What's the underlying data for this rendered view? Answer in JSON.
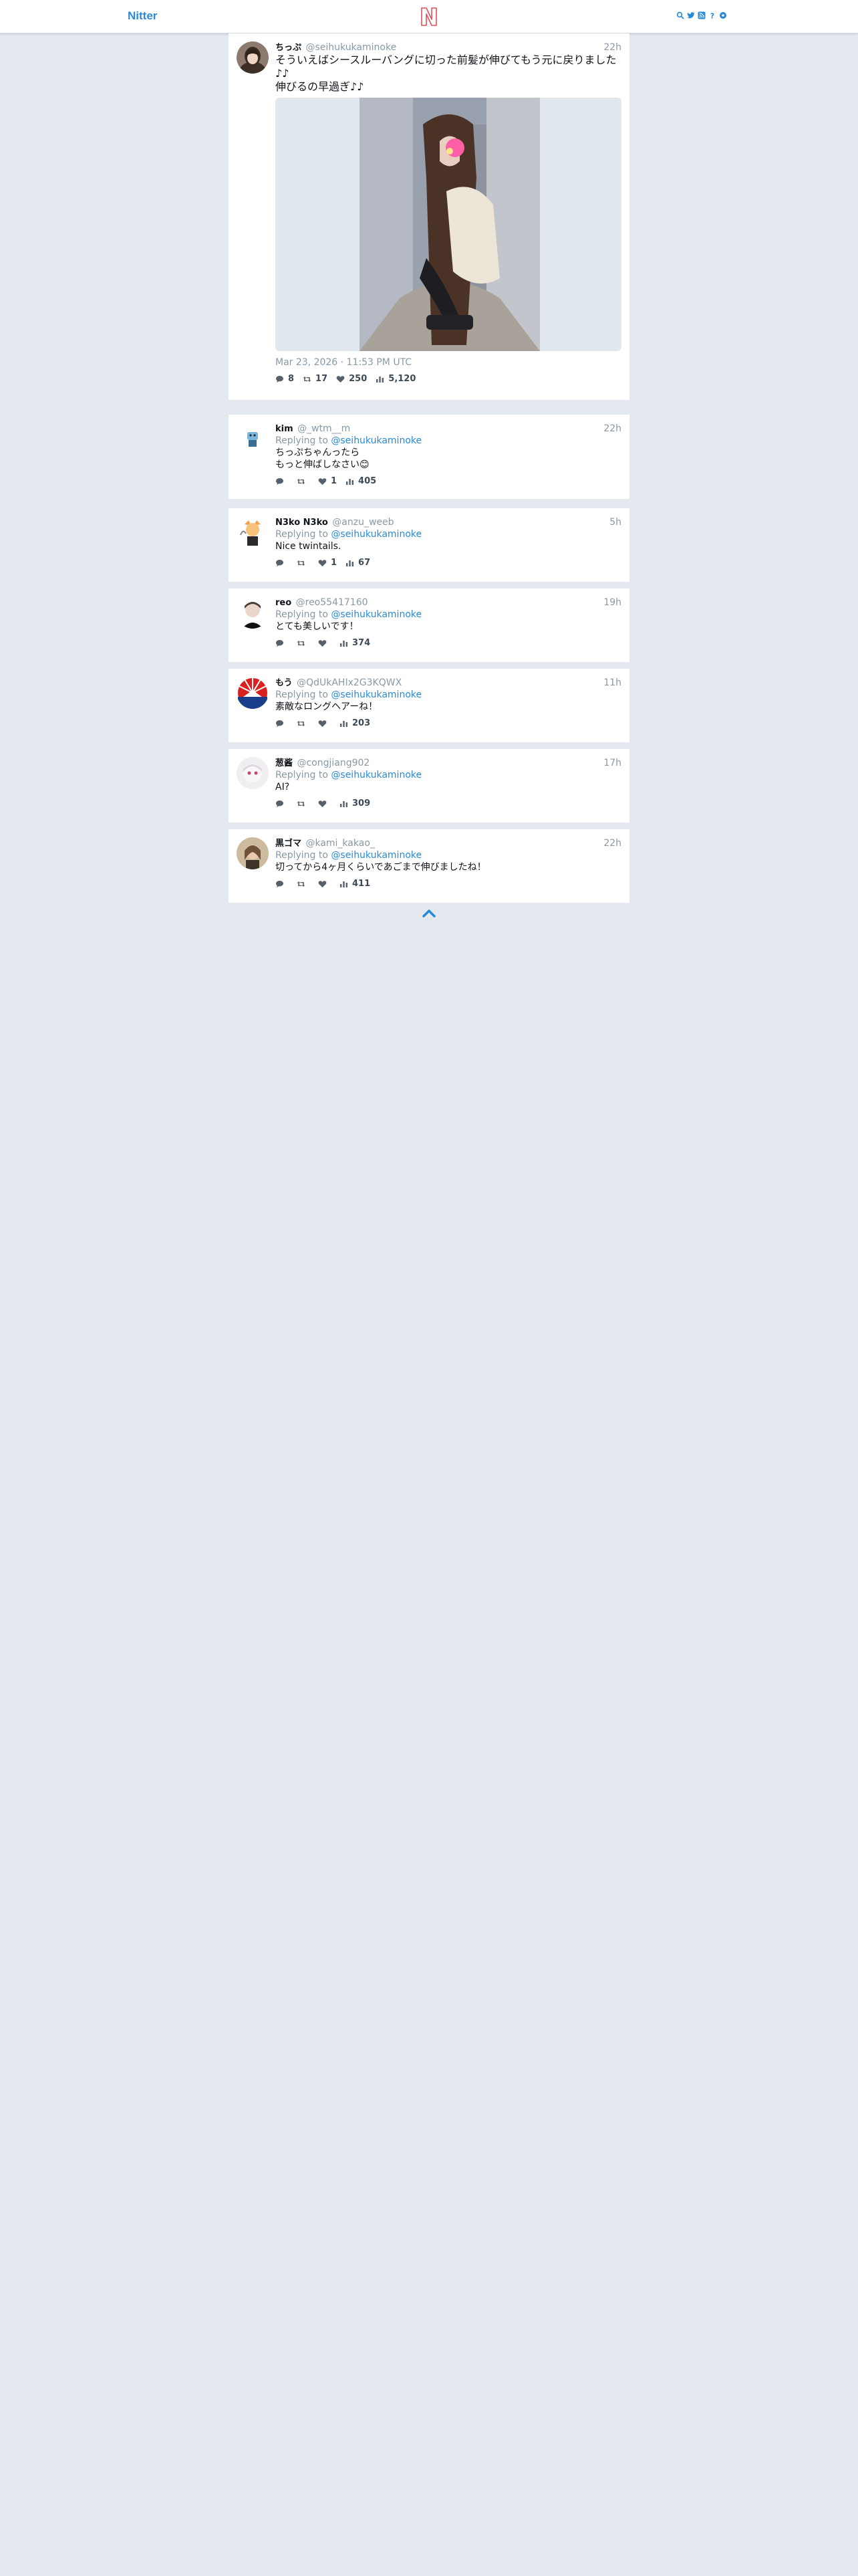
{
  "nav": {
    "brand": "Nitter",
    "logo_letter": "N",
    "icons": [
      "search-icon",
      "twitter-icon",
      "rss-icon",
      "info-icon",
      "settings-icon"
    ]
  },
  "main_tweet": {
    "fullname": "ちっぷ",
    "username": "@seihukukaminoke",
    "date": "22h",
    "text": "そういえばシースルーバングに切った前髪が伸びてもう元に戻りました♪♪\n伸びるの早過ぎ♪♪",
    "published": "Mar 23, 2026 · 11:53 PM UTC",
    "stats": {
      "replies": "8",
      "retweets": "17",
      "likes": "250",
      "views": "5,120"
    }
  },
  "reply_prefix": "Replying to ",
  "replies": [
    {
      "fullname": "kim",
      "username": "@_wtm__m",
      "date": "22h",
      "reply_to": "@seihukukaminoke",
      "text": "ちっぷちゃんったら\nもっと伸ばしなさい😊",
      "stats": {
        "replies": "",
        "retweets": "",
        "likes": "1",
        "views": "405"
      }
    },
    {
      "fullname": "N3ko N3ko",
      "username": "@anzu_weeb",
      "date": "5h",
      "reply_to": "@seihukukaminoke",
      "text": "Nice twintails.",
      "stats": {
        "replies": "",
        "retweets": "",
        "likes": "1",
        "views": "67"
      }
    },
    {
      "fullname": "reo",
      "username": "@reo55417160",
      "date": "19h",
      "reply_to": "@seihukukaminoke",
      "text": "とても美しいです！",
      "stats": {
        "replies": "",
        "retweets": "",
        "likes": "",
        "views": "374"
      }
    },
    {
      "fullname": "もう",
      "username": "@QdUkAHIx2G3KQWX",
      "date": "11h",
      "reply_to": "@seihukukaminoke",
      "text": "素敵なロングヘアーね！",
      "stats": {
        "replies": "",
        "retweets": "",
        "likes": "",
        "views": "203"
      }
    },
    {
      "fullname": "葱酱",
      "username": "@congjiang902",
      "date": "17h",
      "reply_to": "@seihukukaminoke",
      "text": "AI?",
      "stats": {
        "replies": "",
        "retweets": "",
        "likes": "",
        "views": "309"
      }
    },
    {
      "fullname": "黒ゴマ",
      "username": "@kami_kakao_",
      "date": "22h",
      "reply_to": "@seihukukaminoke",
      "text": "切ってから4ヶ月くらいであごまで伸びましたね！",
      "stats": {
        "replies": "",
        "retweets": "",
        "likes": "",
        "views": "411"
      }
    }
  ],
  "colors": {
    "accent": "#2a8ad8",
    "background": "#e4e9f0",
    "card": "#ffffff",
    "muted": "#8899a6"
  }
}
